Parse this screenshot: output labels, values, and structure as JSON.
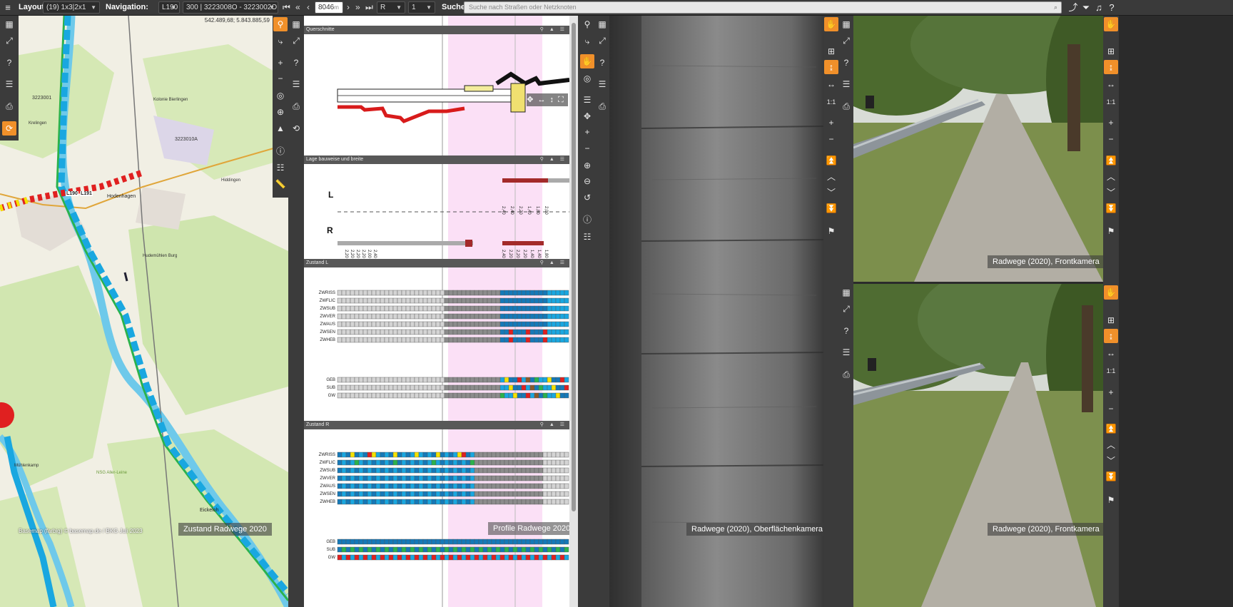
{
  "toolbar": {
    "layout_label": "Layout:",
    "layout_value": "(19) 1x3|2x1",
    "navigation_label": "Navigation:",
    "navigation_road": "L190",
    "navigation_section": "300 | 3223008O - 3223002O",
    "station_value": "8046",
    "station_unit": "m",
    "direction_value": "R",
    "lane_value": "1",
    "search_label": "Suche:",
    "search_placeholder": "Suche nach Straßen oder Netzknoten"
  },
  "map": {
    "coordinates": "542.489,68; 5.843.885,59",
    "caption": "Zustand Radwege 2020",
    "attribution": "Basemap (farbig) © basemap.de / BKG Juli 2023",
    "place_labels": [
      "Hodenhagen",
      "Hudemühlen Burg",
      "Eickeloh",
      "Hiddingen",
      "Kolonie Bierlingen",
      "Krelingen",
      "NSG Aller-Leine",
      "Mühlenkamp"
    ],
    "road_labels": [
      "L190",
      "L191",
      "3223001",
      "3223010A"
    ]
  },
  "profile": {
    "caption": "Profile Radwege 2020",
    "sections": {
      "querschnitte": "Querschnitte",
      "lage": "Lage bauweise und breite",
      "zustand_l": "Zustand L",
      "zustand_r": "Zustand R"
    },
    "side_left": "L",
    "side_right": "R",
    "rows_top": [
      "ZWRISS",
      "ZWFLIC",
      "ZWSUB",
      "ZWVER",
      "ZWAUS",
      "ZWSEN",
      "ZWHEB"
    ],
    "rows_bottom": [
      "GEB",
      "SUB",
      "GW"
    ],
    "width_labels_l": [
      "2,40",
      "2,40",
      "2,20",
      "1,40",
      "1,80",
      "2,00"
    ],
    "width_labels_r": [
      "2,20",
      "2,20",
      "2,20",
      "2,20",
      "2,00",
      "2,40",
      "2,40",
      "2,20",
      "2,20",
      "2,20",
      "1,40",
      "1,40",
      "1,80"
    ]
  },
  "surface_camera": {
    "caption": "Radwege (2020), Oberflächenkamera"
  },
  "front_camera_top": {
    "caption": "Radwege (2020), Frontkamera",
    "scale": "1:1"
  },
  "front_camera_bottom": {
    "caption": "Radwege (2020), Frontkamera",
    "scale": "1:1"
  },
  "colors": {
    "accent": "#f0902a",
    "highlight": "#fbe0f6",
    "good": "#19a7e0",
    "bad": "#e02020",
    "route": "#2bb24c"
  }
}
